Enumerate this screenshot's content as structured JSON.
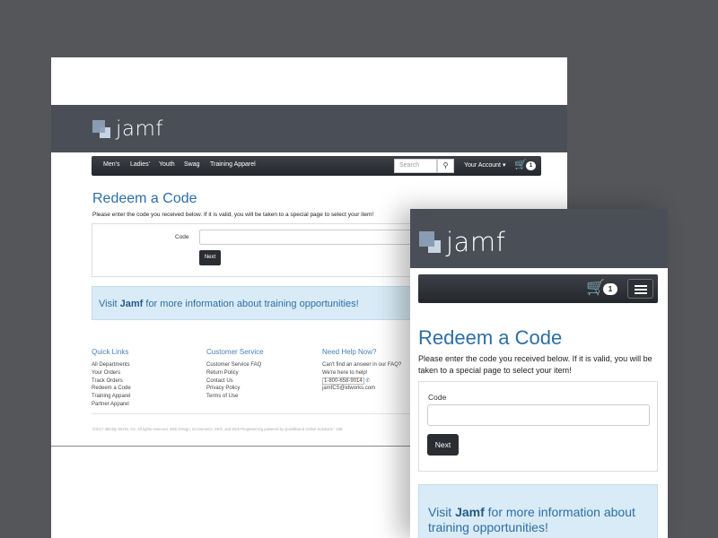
{
  "brand": {
    "name": "jamf"
  },
  "nav": {
    "items": [
      "Men's",
      "Ladies'",
      "Youth",
      "Swag",
      "Training Apparel"
    ],
    "search_placeholder": "Search",
    "search_icon": "magnifier-icon",
    "account": "Your Account",
    "cart_count": "1",
    "cart_icon": "shopping-cart-icon",
    "menu_icon": "hamburger-icon"
  },
  "page": {
    "title": "Redeem a Code",
    "intro": "Please enter the code you received below. If it is valid, you will be taken to a special page to select your item!",
    "code_label": "Code",
    "next_label": "Next",
    "visit_prefix": "Visit ",
    "visit_brand": "Jamf",
    "visit_suffix": " for more information about training opportunities!"
  },
  "footer": {
    "quick_links": {
      "heading": "Quick Links",
      "links": [
        "All Departments",
        "Your Orders",
        "Track Orders",
        "Redeem a Code",
        "Training Apparel",
        "Partner Apparel"
      ]
    },
    "customer_service": {
      "heading": "Customer Service",
      "links": [
        "Customer Service FAQ",
        "Return Policy",
        "Contact Us",
        "Privacy Policy",
        "Terms of Use"
      ]
    },
    "help": {
      "heading": "Need Help Now?",
      "lines": [
        "Can't find an answer in our FAQ?",
        "We're here to help!",
        "1-800-658-9014",
        "jamfCS@idworks.com"
      ]
    },
    "copyright": "©2017 Identity Works, Inc. All rights reserved. Web Design, eCommerce, SEO, and Web Programming powered by QuickBrand Online Solutions - 198"
  },
  "colors": {
    "background": "#55565a",
    "banner": "#4a4f57",
    "navbar": "#2b2e32",
    "title_blue": "#2d6ea5",
    "info_box": "#d9ebf6"
  }
}
